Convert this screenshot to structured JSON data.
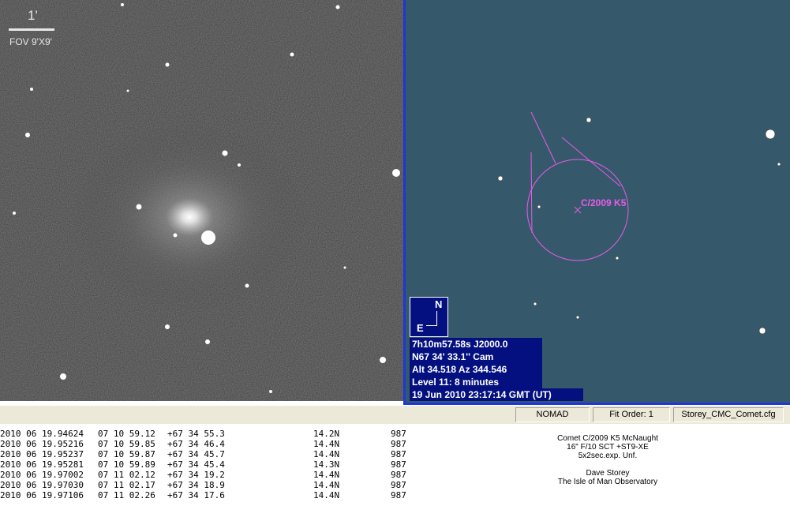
{
  "camera": {
    "scale_label": "1'",
    "fov_label": "FOV 9'X9'"
  },
  "map": {
    "object_label": "C/2009 K5",
    "compass": {
      "north": "N",
      "east": "E"
    },
    "info": [
      " 7h10m57.58s J2000.0",
      "N67 34' 33.1''    Cam",
      "Alt 34.518  Az 344.546",
      "Level 11: 8 minutes",
      "19 Jun 2010 23:17:14 GMT (UT)"
    ],
    "label_color": "#e85ae8",
    "background_color": "#35596b"
  },
  "statusbar": {
    "catalog": "NOMAD",
    "fit_order": "Fit Order: 1",
    "config_file": "Storey_CMC_Comet.cfg"
  },
  "log": {
    "rows": [
      {
        "date": "2010 06 19.94624",
        "ra": "07 10 59.12",
        "dec": "+67 34 55.3",
        "mag": "14.2N",
        "code": "987"
      },
      {
        "date": "2010 06 19.95216",
        "ra": "07 10 59.85",
        "dec": "+67 34 46.4",
        "mag": "14.4N",
        "code": "987"
      },
      {
        "date": "2010 06 19.95237",
        "ra": "07 10 59.87",
        "dec": "+67 34 45.7",
        "mag": "14.4N",
        "code": "987"
      },
      {
        "date": "2010 06 19.95281",
        "ra": "07 10 59.89",
        "dec": "+67 34 45.4",
        "mag": "14.3N",
        "code": "987"
      },
      {
        "date": "2010 06 19.97002",
        "ra": "07 11 02.12",
        "dec": "+67 34 19.2",
        "mag": "14.4N",
        "code": "987"
      },
      {
        "date": "2010 06 19.97030",
        "ra": "07 11 02.17",
        "dec": "+67 34 18.9",
        "mag": "14.4N",
        "code": "987"
      },
      {
        "date": "2010 06 19.97106",
        "ra": "07 11 02.26",
        "dec": "+67 34 17.6",
        "mag": "14.4N",
        "code": "987"
      }
    ]
  },
  "credits": {
    "lines": [
      "Comet C/2009 K5 McNaught",
      "16\" F/10 SCT +ST9-XE",
      "5x2sec.exp. Unf.",
      "",
      "Dave Storey",
      "The Isle of Man Observatory"
    ]
  }
}
